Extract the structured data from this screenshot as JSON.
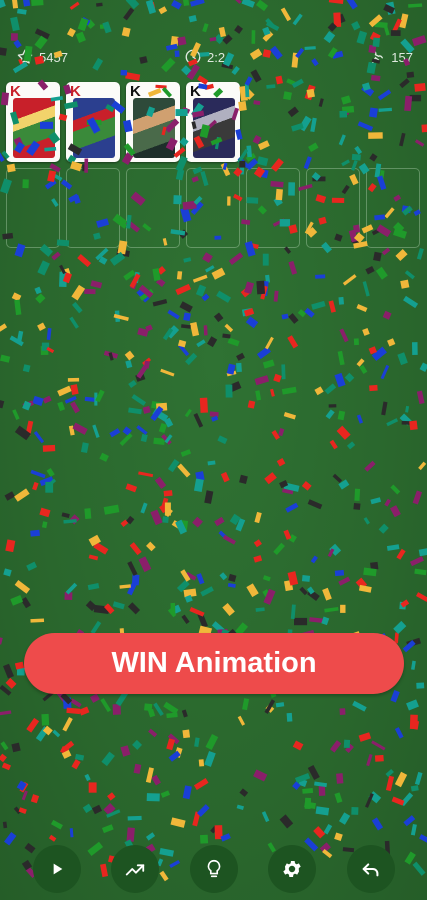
{
  "status": {
    "score": "5457",
    "time": "2:2",
    "moves": "157",
    "score_icon": "star-icon",
    "time_icon": "clock-icon",
    "moves_icon": "moves-icon"
  },
  "foundation": [
    {
      "rank": "K",
      "suit_color": "red",
      "face_colors": [
        "#c8202a",
        "#3a8a3a",
        "#f2d36b"
      ]
    },
    {
      "rank": "K",
      "suit_color": "red",
      "face_colors": [
        "#2b3f8f",
        "#3a8a3a",
        "#c8202a"
      ]
    },
    {
      "rank": "K",
      "suit_color": "black",
      "face_colors": [
        "#2e4a3a",
        "#4a6a4a",
        "#d0a070"
      ]
    },
    {
      "rank": "K",
      "suit_color": "black",
      "face_colors": [
        "#2a2a5a",
        "#3a3a3a",
        "#b0b0c0"
      ]
    }
  ],
  "tableau_slots": 7,
  "win_button": {
    "label": "WIN Animation",
    "color": "#ee4b4b"
  },
  "toolbar": [
    {
      "name": "play-button",
      "icon": "play-icon"
    },
    {
      "name": "stats-button",
      "icon": "trend-icon"
    },
    {
      "name": "hint-button",
      "icon": "lightbulb-icon"
    },
    {
      "name": "settings-button",
      "icon": "gear-icon"
    },
    {
      "name": "undo-button",
      "icon": "undo-icon"
    }
  ],
  "colors": {
    "felt": "#2c6b2f",
    "button_bg": "#1d5421",
    "confetti": [
      "#e8261f",
      "#f0b73a",
      "#1a3fd6",
      "#0f8f6a",
      "#8a1f6a",
      "#1f9a2a",
      "#2a2a2a",
      "#14a090"
    ]
  }
}
